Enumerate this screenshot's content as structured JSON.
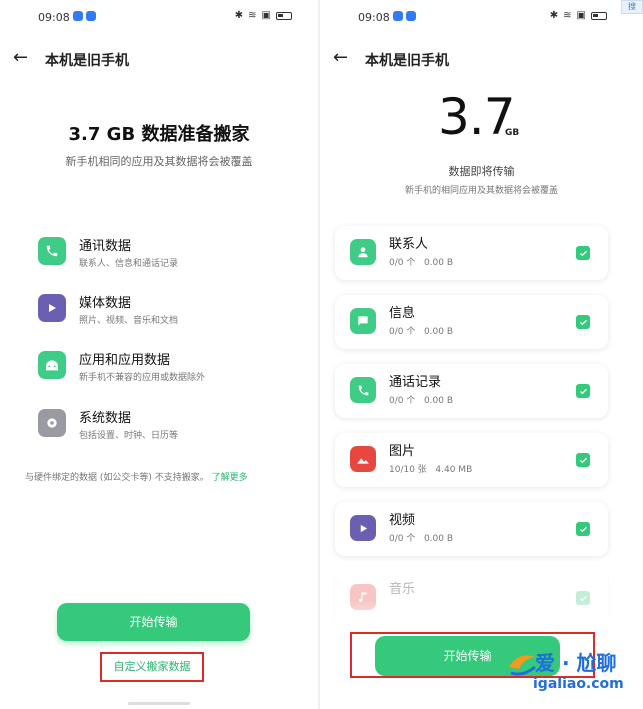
{
  "left": {
    "status": {
      "time": "09:08"
    },
    "header": {
      "title": "本机是旧手机"
    },
    "title": "3.7 GB 数据准备搬家",
    "subtitle": "新手机相同的应用及其数据将会被覆盖",
    "categories": [
      {
        "name": "通讯数据",
        "desc": "联系人、信息和通话记录",
        "icon": "phone-icon",
        "color": "#3fcc86"
      },
      {
        "name": "媒体数据",
        "desc": "照片、视频、音乐和文档",
        "icon": "play-icon",
        "color": "#6a5fb0"
      },
      {
        "name": "应用和应用数据",
        "desc": "新手机不兼容的应用或数据除外",
        "icon": "android-icon",
        "color": "#3fcc86"
      },
      {
        "name": "系统数据",
        "desc": "包括设置、时钟、日历等",
        "icon": "gear-icon",
        "color": "#9a9aa3"
      }
    ],
    "note": "与硬件绑定的数据 (如公交卡等) 不支持搬家。",
    "learn_more": "了解更多",
    "start_button": "开始传输",
    "custom_link": "自定义搬家数据"
  },
  "right": {
    "status": {
      "time": "09:08"
    },
    "header": {
      "title": "本机是旧手机"
    },
    "size": "3.7",
    "unit": "GB",
    "label": "数据即将传输",
    "subtitle": "新手机的相同应用及其数据将会被覆盖",
    "items": [
      {
        "name": "联系人",
        "count": "0/0 个",
        "size": "0.00 B",
        "icon": "contact-icon",
        "color": "#3fcc86",
        "checked": true
      },
      {
        "name": "信息",
        "count": "0/0 个",
        "size": "0.00 B",
        "icon": "message-icon",
        "color": "#3fcc86",
        "checked": true
      },
      {
        "name": "通话记录",
        "count": "0/0 个",
        "size": "0.00 B",
        "icon": "phone-icon",
        "color": "#3fcc86",
        "checked": true
      },
      {
        "name": "图片",
        "count": "10/10 张",
        "size": "4.40 MB",
        "icon": "photo-icon",
        "color": "#e8473f",
        "checked": true
      },
      {
        "name": "视频",
        "count": "0/0 个",
        "size": "0.00 B",
        "icon": "video-icon",
        "color": "#6a5fb0",
        "checked": true
      },
      {
        "name": "音乐",
        "count": "",
        "size": "",
        "icon": "music-icon",
        "color": "#e8473f",
        "checked": true
      }
    ],
    "start_button": "开始传输"
  },
  "watermark": {
    "line1": "爱 · 尬聊",
    "line2": "igaliao.com",
    "corner": "搜"
  }
}
